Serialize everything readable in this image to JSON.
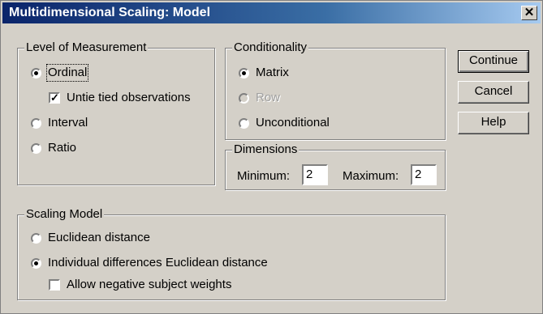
{
  "window": {
    "title": "Multidimensional Scaling: Model",
    "close_icon": "✕"
  },
  "level_of_measurement": {
    "legend": "Level of Measurement",
    "options": [
      {
        "label": "Ordinal",
        "selected": true
      },
      {
        "label": "Interval",
        "selected": false
      },
      {
        "label": "Ratio",
        "selected": false
      }
    ],
    "untie_label": "Untie tied observations",
    "untie_checked": true,
    "check_mark": "✓"
  },
  "conditionality": {
    "legend": "Conditionality",
    "options": [
      {
        "label": "Matrix",
        "selected": true,
        "enabled": true
      },
      {
        "label": "Row",
        "selected": false,
        "enabled": false
      },
      {
        "label": "Unconditional",
        "selected": false,
        "enabled": true
      }
    ]
  },
  "dimensions": {
    "legend": "Dimensions",
    "min_label": "Minimum:",
    "min_value": "2",
    "max_label": "Maximum:",
    "max_value": "2"
  },
  "scaling_model": {
    "legend": "Scaling Model",
    "options": [
      {
        "label": "Euclidean distance",
        "selected": false
      },
      {
        "label": "Individual differences Euclidean distance",
        "selected": true
      }
    ],
    "neg_weights_label": "Allow negative subject weights",
    "neg_weights_checked": false
  },
  "buttons": {
    "continue": "Continue",
    "cancel": "Cancel",
    "help": "Help"
  },
  "colors": {
    "face": "#d4d0c8",
    "title_start": "#0a246a",
    "title_end": "#a6caf0"
  }
}
